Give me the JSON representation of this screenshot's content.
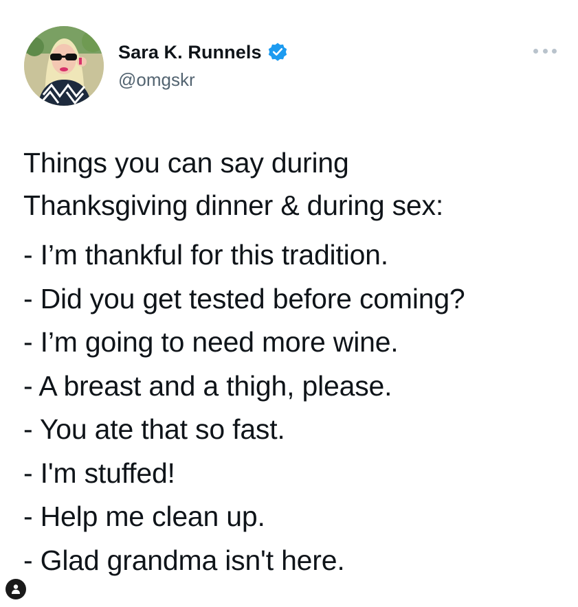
{
  "author": {
    "display_name": "Sara K. Runnels",
    "handle": "@omgskr",
    "verified": true
  },
  "tweet": {
    "intro_lines": [
      "Things you can say during",
      "Thanksgiving dinner & during sex:"
    ],
    "items": [
      "- I’m thankful for this tradition.",
      "- Did you get tested before coming?",
      "- I’m going to need more wine.",
      "- A breast and a thigh, please.",
      "- You ate that so fast.",
      "- I'm stuffed!",
      "- Help me clean up.",
      "- Glad grandma isn't here."
    ]
  },
  "icons": {
    "verified": "verified-badge-icon",
    "more": "more-options-icon",
    "profile": "user-profile-icon"
  },
  "colors": {
    "text": "#0f1419",
    "handle": "#536471",
    "verified": "#1d9bf0",
    "more_dots": "#b9c3cc"
  }
}
